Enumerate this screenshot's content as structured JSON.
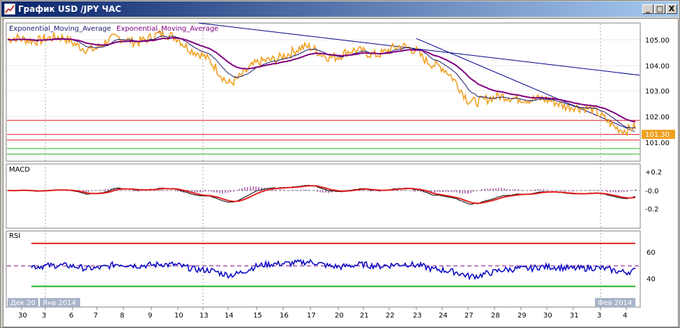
{
  "window": {
    "title": "График USD /JPY ЧАС",
    "buttons": {
      "minimize": "_",
      "maximize": "□",
      "close": "X"
    }
  },
  "main_panel": {
    "legend_1": "Exponential_Moving_Average",
    "legend_2": "Exponential_Moving_Average",
    "price_ticks": [
      "105.00",
      "104.00",
      "103.00",
      "102.00",
      "101.00"
    ],
    "current_price": "101.30"
  },
  "macd_panel": {
    "label": "MACD",
    "ticks": [
      "+0.2",
      "-0.0",
      "-0.2"
    ]
  },
  "rsi_panel": {
    "label": "RSI",
    "ticks": [
      "60",
      "40"
    ]
  },
  "time_axis": {
    "month_labels": [
      "Дек 20",
      "Янв 2014",
      "Фев 2014"
    ],
    "day_labels": [
      "30",
      "3",
      "6",
      "7",
      "8",
      "9",
      "10",
      "13",
      "14",
      "15",
      "16",
      "17",
      "20",
      "21",
      "22",
      "23",
      "24",
      "27",
      "28",
      "29",
      "30",
      "31",
      "3",
      "4"
    ]
  },
  "colors": {
    "price": "#f0a020",
    "ema_fast": "#1a1a6e",
    "ema_slow": "#800080",
    "trendline": "#00008b",
    "resistance": "#e02020",
    "support": "#20b020",
    "rsi": "#0000c0",
    "macd_signal": "#e02020"
  },
  "chart_data": {
    "type": "line",
    "title": "График USD /JPY ЧАС",
    "x": [
      "30",
      "3",
      "6",
      "7",
      "8",
      "9",
      "10",
      "13",
      "14",
      "15",
      "16",
      "17",
      "20",
      "21",
      "22",
      "23",
      "24",
      "27",
      "28",
      "29",
      "30",
      "31",
      "3",
      "4"
    ],
    "series": [
      {
        "name": "Exponential_Moving_Average",
        "values": [
          104.8,
          105.0,
          104.7,
          104.6,
          104.9,
          104.9,
          105.0,
          104.2,
          103.4,
          103.9,
          104.4,
          104.5,
          104.3,
          104.4,
          104.5,
          104.5,
          103.8,
          102.8,
          102.7,
          102.9,
          102.6,
          102.6,
          102.1,
          101.7
        ]
      }
    ],
    "ylim": [
      100.6,
      105.4
    ],
    "horizontal_levels": [
      102.0,
      101.5,
      101.3,
      101.0,
      100.8
    ],
    "macd": {
      "ylim": [
        -0.35,
        0.3
      ]
    },
    "rsi": {
      "levels": [
        30,
        70
      ]
    }
  }
}
